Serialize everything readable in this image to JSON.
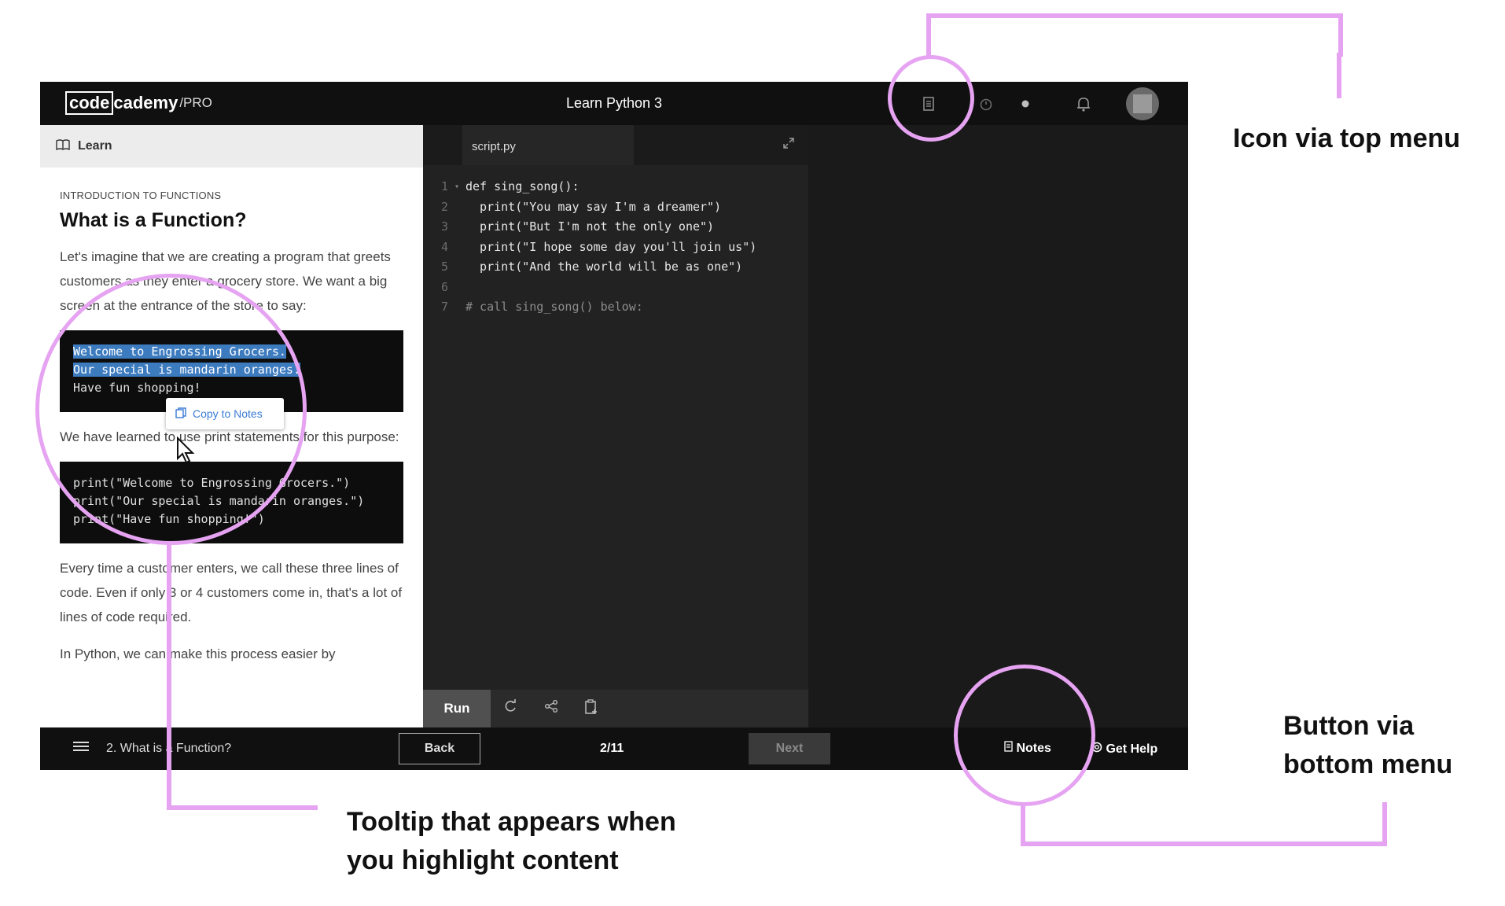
{
  "app": {
    "logo_code": "code",
    "logo_cademy": "cademy",
    "logo_pro": "/PRO",
    "course_title": "Learn Python 3"
  },
  "learn": {
    "header_label": "Learn",
    "kicker": "INTRODUCTION TO FUNCTIONS",
    "title": "What is a Function?",
    "para1": "Let's imagine that we are creating a program that greets customers as they enter a grocery store. We want a big screen at the entrance of the store to say:",
    "code1": [
      "Welcome to Engrossing Grocers.",
      "Our special is mandarin oranges.",
      "Have fun shopping!"
    ],
    "para2": "We have learned to use print statements for this purpose:",
    "code2": [
      "print(\"Welcome to Engrossing Grocers.\")",
      "print(\"Our special is mandarin oranges.\")",
      "print(\"Have fun shopping!\")"
    ],
    "para3": "Every time a customer enters, we call these three lines of code. Even if only 3 or 4 customers come in, that's a lot of lines of code required.",
    "para4": "In Python, we can make this process easier by",
    "tooltip_label": "Copy to Notes"
  },
  "editor": {
    "tab_name": "script.py",
    "lines": [
      {
        "no": "1",
        "text": "def sing_song():",
        "fold": "▾"
      },
      {
        "no": "2",
        "text": "  print(\"You may say I'm a dreamer\")"
      },
      {
        "no": "3",
        "text": "  print(\"But I'm not the only one\")"
      },
      {
        "no": "4",
        "text": "  print(\"I hope some day you'll join us\")"
      },
      {
        "no": "5",
        "text": "  print(\"And the world will be as one\")"
      },
      {
        "no": "6",
        "text": ""
      },
      {
        "no": "7",
        "text": "# call sing_song() below:",
        "comment": true
      }
    ],
    "run_label": "Run"
  },
  "bottom": {
    "crumb": "2. What is a Function?",
    "back_label": "Back",
    "progress": "2/11",
    "next_label": "Next",
    "notes_label": "Notes",
    "help_label": "Get Help"
  },
  "annotations": {
    "top": "Icon via top menu",
    "bottom_line1": "Button via",
    "bottom_line2": "bottom menu",
    "tooltip_line1": "Tooltip that appears when",
    "tooltip_line2": "you highlight content"
  },
  "icons": {
    "notes_top": "notes-icon",
    "timer": "timer-icon",
    "dot": "status-dot-icon",
    "bell": "bell-icon",
    "book": "book-icon",
    "expand": "expand-icon",
    "refresh": "refresh-icon",
    "share": "share-icon",
    "clipboard": "clipboard-add-icon",
    "menu": "hamburger-menu-icon",
    "help": "help-icon"
  },
  "colors": {
    "annotation_accent": "#e6a3f2",
    "highlight": "#3d7bbf",
    "tooltip_text": "#3a7bd5"
  }
}
